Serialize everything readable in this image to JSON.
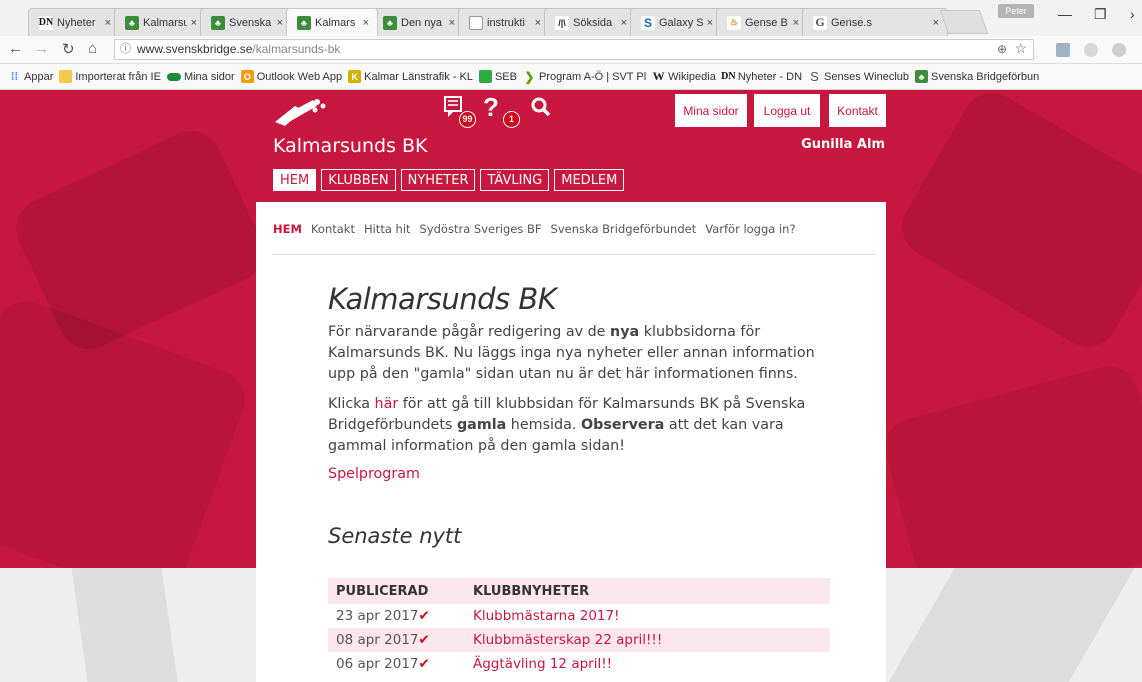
{
  "browser": {
    "tabs": [
      {
        "title": "Nyheter",
        "icon": "dn-icon"
      },
      {
        "title": "Kalmarsu",
        "icon": "svenskbridge-icon"
      },
      {
        "title": "Svenska",
        "icon": "svenskbridge-icon"
      },
      {
        "title": "Kalmars",
        "icon": "svenskbridge-icon"
      },
      {
        "title": "Den nya",
        "icon": "svenskbridge-icon"
      },
      {
        "title": "instrukti",
        "icon": "document-icon"
      },
      {
        "title": "Söksida",
        "icon": "search-site-icon"
      },
      {
        "title": "Galaxy S",
        "icon": "s-icon"
      },
      {
        "title": "Gense B",
        "icon": "gense-icon"
      },
      {
        "title": "Gense.s",
        "icon": "g-icon"
      }
    ],
    "tab_close": "×",
    "profile_name": "Peter",
    "url_domain": "www.svenskbridge.se",
    "url_path": "/kalmarsunds-bk",
    "bookmarks": [
      {
        "label": "Appar",
        "icon": "apps-icon"
      },
      {
        "label": "Importerat från IE",
        "icon": "folder-icon"
      },
      {
        "label": "Mina sidor",
        "icon": "pill-icon"
      },
      {
        "label": "Outlook Web App",
        "icon": "outlook-icon"
      },
      {
        "label": "Kalmar Länstrafik - KL",
        "icon": "klt-icon"
      },
      {
        "label": "SEB",
        "icon": "seb-icon"
      },
      {
        "label": "Program A-Ö | SVT Pl",
        "icon": "svt-icon"
      },
      {
        "label": "Wikipedia",
        "icon": "wikipedia-icon"
      },
      {
        "label": "Nyheter - DN",
        "icon": "dn-icon"
      },
      {
        "label": "Senses Wineclub",
        "icon": "s-icon"
      },
      {
        "label": "Svenska Bridgeförbun",
        "icon": "svenskbridge-icon"
      }
    ]
  },
  "header": {
    "messages_count": "99",
    "help_count": "1",
    "mina_sidor": "Mina sidor",
    "logga_ut": "Logga ut",
    "kontakt": "Kontakt",
    "site_title": "Kalmarsunds BK",
    "user_name": "Gunilla Alm",
    "nav": [
      "HEM",
      "KLUBBEN",
      "NYHETER",
      "TÄVLING",
      "MEDLEM"
    ]
  },
  "subnav": [
    "HEM",
    "Kontakt",
    "Hitta hit",
    "Sydöstra Sveriges BF",
    "Svenska Bridgeförbundet",
    "Varför logga in?"
  ],
  "article": {
    "title": "Kalmarsunds BK",
    "p1_a": "För närvarande pågår redigering av de ",
    "p1_bold": "nya",
    "p1_b": " klubbsidorna för Kalmarsunds BK. Nu läggs inga nya nyheter eller annan information upp på den \"gamla\" sidan utan nu är det här informationen finns.",
    "p2_a": "Klicka ",
    "p2_link": "här",
    "p2_b": " för att gå till klubbsidan för Kalmarsunds BK på Svenska Bridgeförbundets ",
    "p2_bold1": "gamla",
    "p2_c": " hemsida. ",
    "p2_bold2": "Observera",
    "p2_d": " att det kan vara gammal information på den gamla sidan!",
    "spelprogram": "Spelprogram",
    "news_heading": "Senaste nytt"
  },
  "news": {
    "col_published": "PUBLICERAD",
    "col_news": "KLUBBNYHETER",
    "rows": [
      {
        "date": "23 apr 2017",
        "title": "Klubbmästarna 2017!"
      },
      {
        "date": "08 apr 2017",
        "title": "Klubbmästerskap 22 april!!!"
      },
      {
        "date": "06 apr 2017",
        "title": "Äggtävling 12 april!!"
      }
    ],
    "check": "✔"
  },
  "colors": {
    "accent": "#c8173e"
  }
}
